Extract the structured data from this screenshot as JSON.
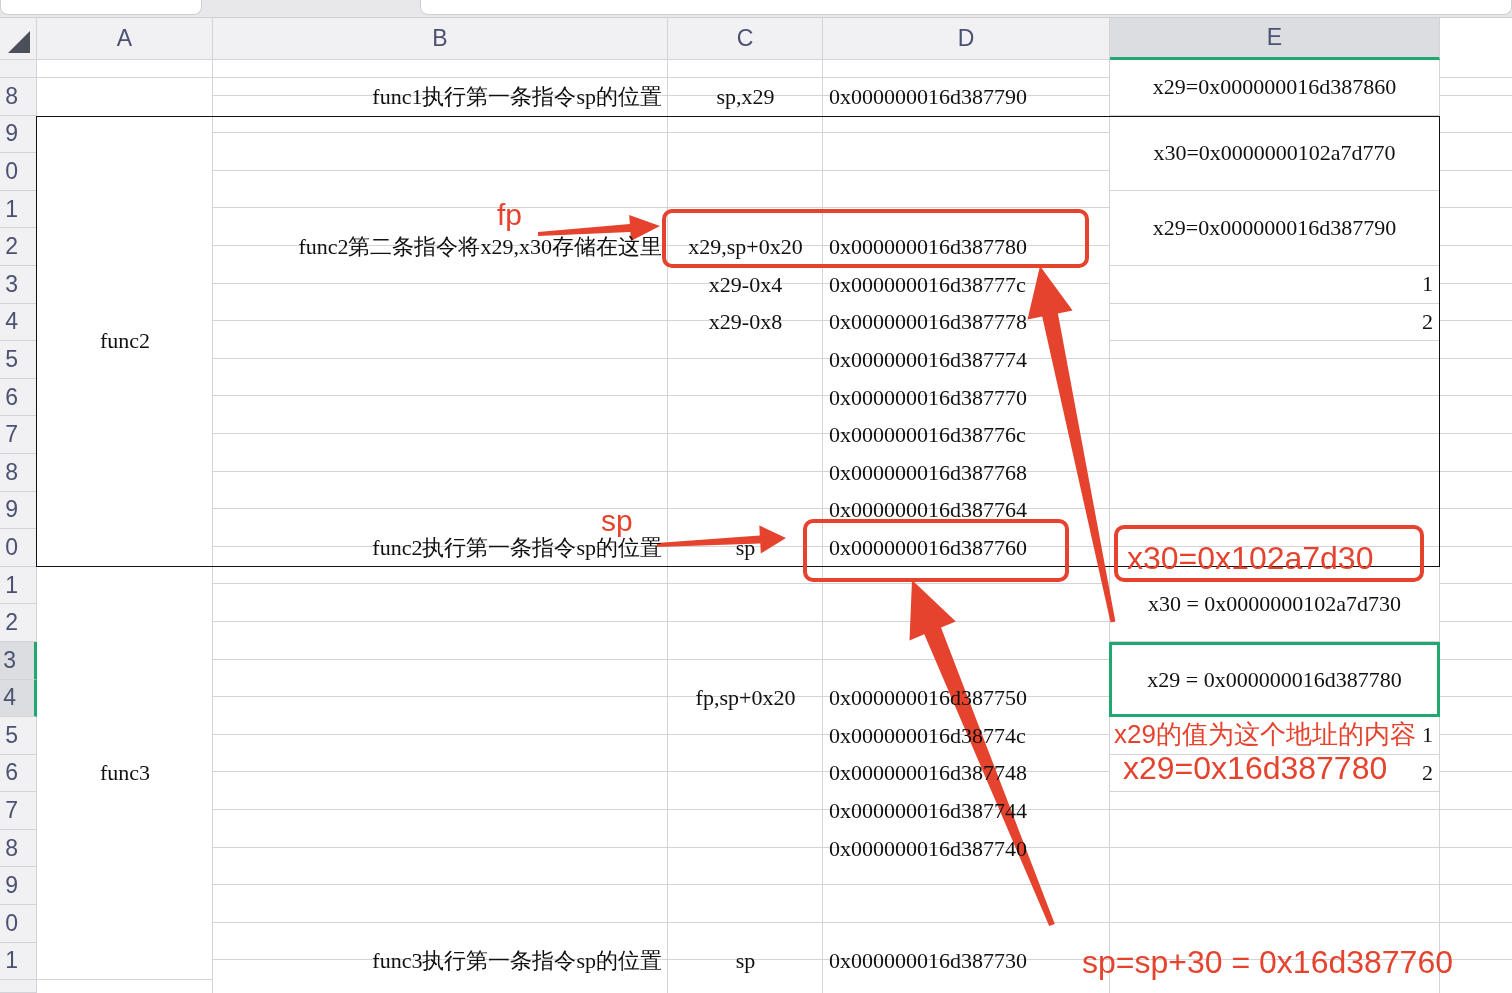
{
  "column_headers": [
    {
      "label": "A",
      "selected": false
    },
    {
      "label": "B",
      "selected": false
    },
    {
      "label": "C",
      "selected": false
    },
    {
      "label": "D",
      "selected": false
    },
    {
      "label": "E",
      "selected": true
    }
  ],
  "blocks": [
    {
      "outlined": false,
      "rows": [
        {
          "e": {
            "text": "x29=0x000000016d387860",
            "merged": true,
            "kind": "text",
            "selected": false
          }
        },
        {
          "number": "8",
          "selected": false,
          "b": "func1执行第一条指令sp的位置",
          "c": "sp,x29",
          "d": "0x000000016d387790"
        }
      ]
    },
    {
      "name": "func2",
      "outlined": true,
      "rows": [
        {
          "number": "9",
          "selected": false,
          "e": {
            "text": "x30=0x0000000102a7d770",
            "merged": true,
            "kind": "text",
            "selected": false
          }
        },
        {
          "number": "0",
          "selected": false
        },
        {
          "number": "1",
          "selected": false,
          "e": {
            "text": "x29=0x000000016d387790",
            "merged": true,
            "kind": "text",
            "selected": false
          }
        },
        {
          "number": "2",
          "selected": false,
          "b": "func2第二条指令将x29,x30存储在这里",
          "c": "x29,sp+0x20",
          "d": "0x000000016d387780"
        },
        {
          "number": "3",
          "selected": false,
          "c": "x29-0x4",
          "d": "0x000000016d38777c",
          "e": {
            "text": "1",
            "merged": false,
            "kind": "number",
            "selected": false
          }
        },
        {
          "number": "4",
          "selected": false,
          "c": "x29-0x8",
          "d": "0x000000016d387778",
          "e": {
            "text": "2",
            "merged": false,
            "kind": "number",
            "selected": false
          }
        },
        {
          "number": "5",
          "selected": false,
          "d": "0x000000016d387774"
        },
        {
          "number": "6",
          "selected": false,
          "d": "0x000000016d387770"
        },
        {
          "number": "7",
          "selected": false,
          "d": "0x000000016d38776c"
        },
        {
          "number": "8",
          "selected": false,
          "d": "0x000000016d387768"
        },
        {
          "number": "9",
          "selected": false,
          "d": "0x000000016d387764"
        },
        {
          "number": "0",
          "selected": false,
          "b": "func2执行第一条指令sp的位置",
          "c": "sp",
          "d": "0x000000016d387760"
        }
      ]
    },
    {
      "name": "func3",
      "outlined": false,
      "rows": [
        {
          "number": "1",
          "selected": false,
          "e": {
            "text": "x30 = 0x0000000102a7d730",
            "merged": true,
            "kind": "text",
            "selected": false
          }
        },
        {
          "number": "2",
          "selected": false
        },
        {
          "number": "3",
          "selected": true,
          "e": {
            "text": "x29 = 0x000000016d387780",
            "merged": true,
            "kind": "text",
            "selected": true
          }
        },
        {
          "number": "4",
          "selected": true,
          "c": "fp,sp+0x20",
          "d": "0x000000016d387750"
        },
        {
          "number": "5",
          "selected": false,
          "d": "0x000000016d38774c",
          "e": {
            "text": "1",
            "merged": false,
            "kind": "number",
            "selected": false
          }
        },
        {
          "number": "6",
          "selected": false,
          "d": "0x000000016d387748",
          "e": {
            "text": "2",
            "merged": false,
            "kind": "number",
            "selected": false
          }
        },
        {
          "number": "7",
          "selected": false,
          "d": "0x000000016d387744"
        },
        {
          "number": "8",
          "selected": false,
          "d": "0x000000016d387740"
        },
        {
          "number": "9",
          "selected": false
        },
        {
          "number": "0",
          "selected": false
        },
        {
          "number": "1",
          "selected": false,
          "b": "func3执行第一条指令sp的位置",
          "c": "sp",
          "d": "0x000000016d387730"
        }
      ]
    },
    {
      "outlined": false,
      "rows": [
        {
          "selected": false
        }
      ]
    }
  ],
  "annotations": [
    {
      "text": "fp"
    },
    {
      "text": "sp"
    },
    {
      "text": "x30=0x102a7d30"
    },
    {
      "text": "x29的值为这个地址的内容"
    },
    {
      "text": "x29=0x16d387780"
    },
    {
      "text": "sp=sp+30 = 0x16d387760"
    }
  ]
}
